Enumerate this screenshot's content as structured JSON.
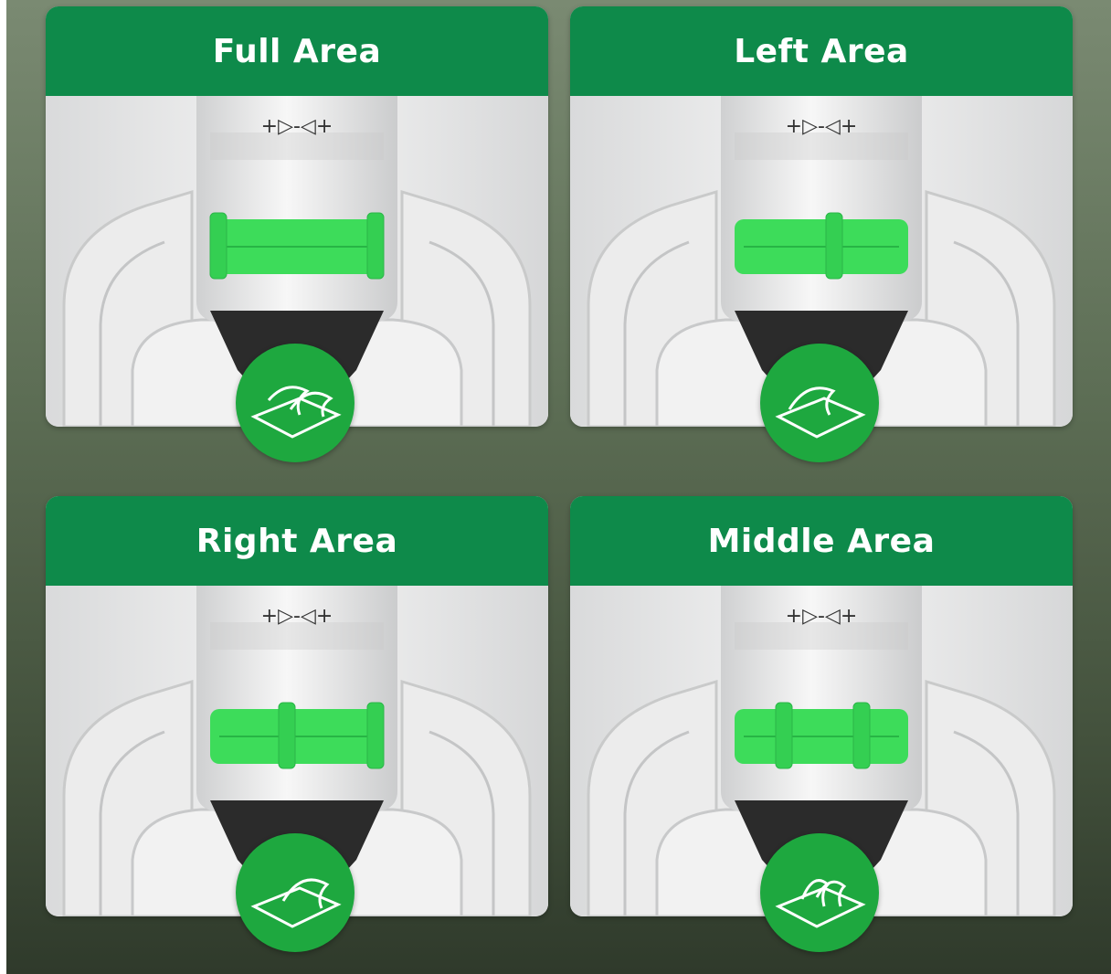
{
  "cards": [
    {
      "title": "Full Area",
      "mode": "full"
    },
    {
      "title": "Left Area",
      "mode": "left"
    },
    {
      "title": "Right Area",
      "mode": "right"
    },
    {
      "title": "Middle Area",
      "mode": "middle"
    }
  ],
  "colors": {
    "header_green": "#0e8a4a",
    "knob_green": "#3ddc5a",
    "badge_green": "#1ea83f",
    "body_white": "#e9eaea"
  },
  "icons": [
    "full-area-paper-icon",
    "left-area-paper-icon",
    "right-area-paper-icon",
    "middle-area-paper-icon"
  ]
}
